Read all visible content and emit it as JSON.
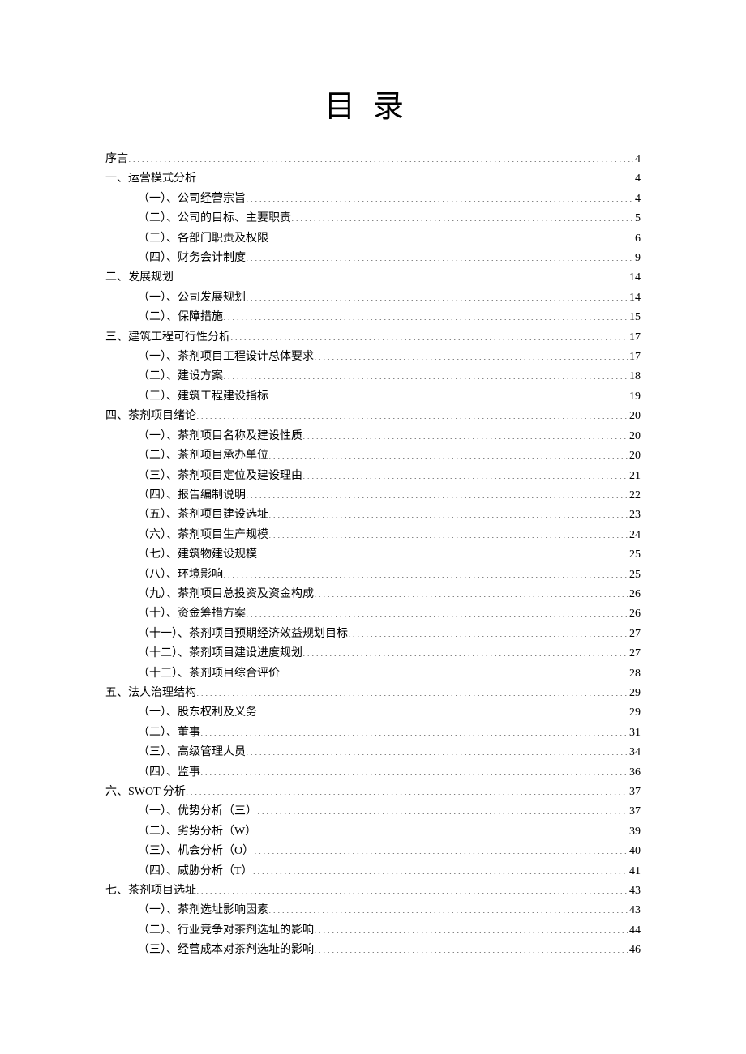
{
  "title": "目录",
  "entries": [
    {
      "level": 0,
      "label": "序言",
      "page": "4"
    },
    {
      "level": 0,
      "label": "一、运营模式分析",
      "page": "4"
    },
    {
      "level": 1,
      "label": "（一）、公司经营宗旨",
      "page": "4"
    },
    {
      "level": 1,
      "label": "（二）、公司的目标、主要职责",
      "page": "5"
    },
    {
      "level": 1,
      "label": "（三）、各部门职责及权限",
      "page": "6"
    },
    {
      "level": 1,
      "label": "（四）、财务会计制度",
      "page": "9"
    },
    {
      "level": 0,
      "label": "二、发展规划",
      "page": "14"
    },
    {
      "level": 1,
      "label": "（一）、公司发展规划",
      "page": "14"
    },
    {
      "level": 1,
      "label": "（二）、保障措施",
      "page": "15"
    },
    {
      "level": 0,
      "label": "三、建筑工程可行性分析",
      "page": "17"
    },
    {
      "level": 1,
      "label": "（一）、茶剂项目工程设计总体要求",
      "page": "17"
    },
    {
      "level": 1,
      "label": "（二）、建设方案",
      "page": "18"
    },
    {
      "level": 1,
      "label": "（三）、建筑工程建设指标",
      "page": "19"
    },
    {
      "level": 0,
      "label": "四、茶剂项目绪论",
      "page": "20"
    },
    {
      "level": 1,
      "label": "（一）、茶剂项目名称及建设性质",
      "page": "20"
    },
    {
      "level": 1,
      "label": "（二）、茶剂项目承办单位",
      "page": "20"
    },
    {
      "level": 1,
      "label": "（三）、茶剂项目定位及建设理由",
      "page": "21"
    },
    {
      "level": 1,
      "label": "（四）、报告编制说明",
      "page": "22"
    },
    {
      "level": 1,
      "label": "（五）、茶剂项目建设选址",
      "page": "23"
    },
    {
      "level": 1,
      "label": "（六）、茶剂项目生产规模",
      "page": "24"
    },
    {
      "level": 1,
      "label": "（七）、建筑物建设规模",
      "page": "25"
    },
    {
      "level": 1,
      "label": "（八）、环境影响",
      "page": "25"
    },
    {
      "level": 1,
      "label": "（九）、茶剂项目总投资及资金构成",
      "page": "26"
    },
    {
      "level": 1,
      "label": "（十）、资金筹措方案",
      "page": "26"
    },
    {
      "level": 1,
      "label": "（十一）、茶剂项目预期经济效益规划目标",
      "page": "27"
    },
    {
      "level": 1,
      "label": "（十二）、茶剂项目建设进度规划",
      "page": "27"
    },
    {
      "level": 1,
      "label": "（十三）、茶剂项目综合评价",
      "page": "28"
    },
    {
      "level": 0,
      "label": "五、法人治理结构",
      "page": "29"
    },
    {
      "level": 1,
      "label": "（一）、股东权利及义务",
      "page": "29"
    },
    {
      "level": 1,
      "label": "（二）、董事",
      "page": "31"
    },
    {
      "level": 1,
      "label": "（三）、高级管理人员",
      "page": "34"
    },
    {
      "level": 1,
      "label": "（四）、监事",
      "page": "36"
    },
    {
      "level": 0,
      "label": "六、SWOT 分析",
      "page": "37"
    },
    {
      "level": 1,
      "label": "（一）、优势分析（三）",
      "page": "37"
    },
    {
      "level": 1,
      "label": "（二）、劣势分析（W）",
      "page": "39"
    },
    {
      "level": 1,
      "label": "（三）、机会分析（O）",
      "page": "40"
    },
    {
      "level": 1,
      "label": "（四）、威胁分析（T）",
      "page": "41"
    },
    {
      "level": 0,
      "label": "七、茶剂项目选址",
      "page": "43"
    },
    {
      "level": 1,
      "label": "（一）、茶剂选址影响因素",
      "page": "43"
    },
    {
      "level": 1,
      "label": "（二）、行业竞争对茶剂选址的影响",
      "page": "44"
    },
    {
      "level": 1,
      "label": "（三）、经营成本对茶剂选址的影响",
      "page": "46"
    }
  ]
}
